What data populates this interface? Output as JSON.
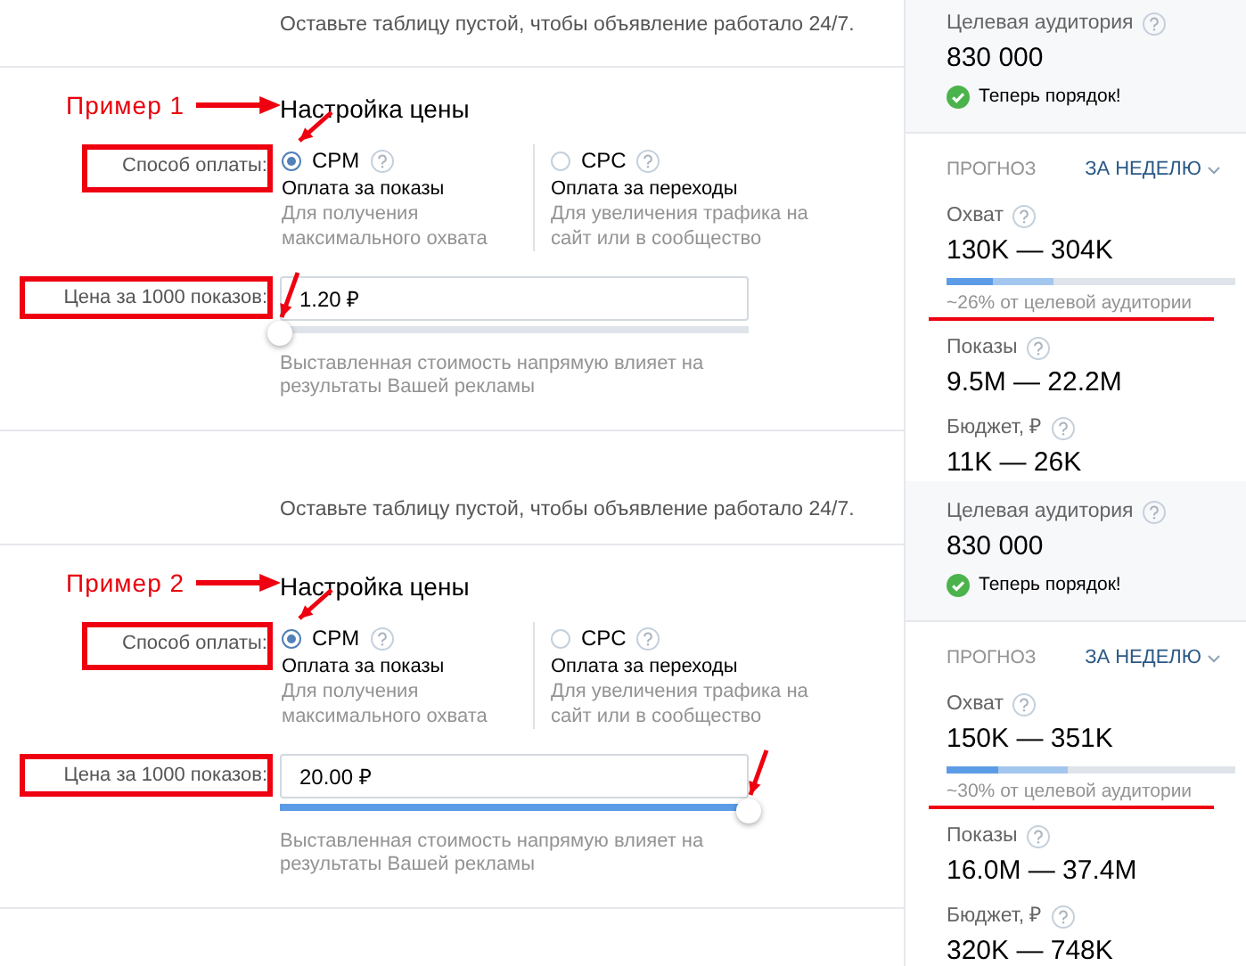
{
  "examples": [
    {
      "annotation": "Пример 1",
      "schedule_hint": "Оставьте таблицу пустой, чтобы объявление работало 24/7.",
      "title": "Настройка цены",
      "payment": {
        "label": "Способ оплаты:",
        "options": [
          {
            "name": "CPM",
            "selected": true,
            "caption": "Оплата за показы",
            "description": "Для получения максимального охвата"
          },
          {
            "name": "CPC",
            "selected": false,
            "caption": "Оплата за переходы",
            "description": "Для увеличения трафика на сайт или в сообщество"
          }
        ]
      },
      "price": {
        "label": "Цена за 1000 показов:",
        "value": "1.20 ₽",
        "level": 0,
        "hint": "Выставленная стоимость напрямую влияет на результаты Вашей рекламы"
      },
      "audience": {
        "label": "Целевая аудитория",
        "value": "830 000",
        "status": "Теперь порядок!"
      },
      "forecast": {
        "title": "ПРОГНОЗ",
        "period": "ЗА НЕДЕЛЮ",
        "reach": {
          "label": "Охват",
          "value": "130K — 304K",
          "bar": [
            {
              "level": 0.16
            },
            {
              "level": 0.37
            }
          ],
          "share": "~26% от целевой аудитории"
        },
        "impressions": {
          "label": "Показы",
          "value": "9.5M — 22.2M"
        },
        "budget": {
          "label": "Бюджет, ₽",
          "value": "11K — 26K"
        }
      }
    },
    {
      "annotation": "Пример 2",
      "schedule_hint": "Оставьте таблицу пустой, чтобы объявление работало 24/7.",
      "title": "Настройка цены",
      "payment": {
        "label": "Способ оплаты:",
        "options": [
          {
            "name": "CPM",
            "selected": true,
            "caption": "Оплата за показы",
            "description": "Для получения максимального охвата"
          },
          {
            "name": "CPC",
            "selected": false,
            "caption": "Оплата за переходы",
            "description": "Для увеличения трафика на сайт или в сообщество"
          }
        ]
      },
      "price": {
        "label": "Цена за 1000 показов:",
        "value": "20.00 ₽",
        "level": 1,
        "hint": "Выставленная стоимость напрямую влияет на результаты Вашей рекламы"
      },
      "audience": {
        "label": "Целевая аудитория",
        "value": "830 000",
        "status": "Теперь порядок!"
      },
      "forecast": {
        "title": "ПРОГНОЗ",
        "period": "ЗА НЕДЕЛЮ",
        "reach": {
          "label": "Охват",
          "value": "150K — 351K",
          "bar": [
            {
              "level": 0.18
            },
            {
              "level": 0.42
            }
          ],
          "share": "~30% от целевой аудитории"
        },
        "impressions": {
          "label": "Показы",
          "value": "16.0M — 37.4M"
        },
        "budget": {
          "label": "Бюджет, ₽",
          "value": "320K — 748K"
        }
      }
    }
  ]
}
